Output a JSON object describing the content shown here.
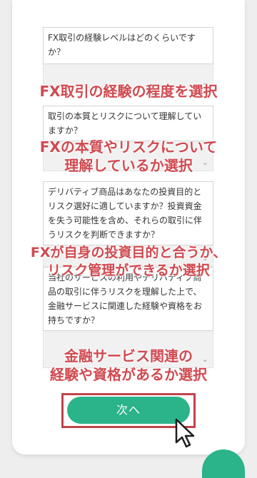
{
  "questions": [
    {
      "text": "FX取引の経験レベルはどのくらいですか？"
    },
    {
      "text": "取引の本質とリスクについて理解していますか？"
    },
    {
      "text": "デリバティブ商品はあなたの投資目的とリスク選好に適していますか？投資資金を失う可能性を含め、それらの取引に伴うリスクを判断できますか？"
    },
    {
      "text": "当社のサービスの利用やデリバティブ商品の取引に伴うリスクを理解した上で、金融サービスに関連した経験や資格をお持ちですか？"
    }
  ],
  "annotations": [
    {
      "line1": "FX取引の経験の程度を選択"
    },
    {
      "line1": "FXの本質やリスクについて",
      "line2": "理解しているか選択"
    },
    {
      "line1": "FXが自身の投資目的と合うか、",
      "line2": "リスク管理ができるか選択"
    },
    {
      "line1": "金融サービス関連の",
      "line2": "経験や資格があるか選択"
    }
  ],
  "next_button_label": "次へ",
  "colors": {
    "accent": "#2bb38a",
    "annotation": "#d04a50",
    "highlight_border": "#c0444b"
  },
  "icons": {
    "dropdown": "chevron-down-icon",
    "cursor": "mouse-cursor-icon"
  }
}
